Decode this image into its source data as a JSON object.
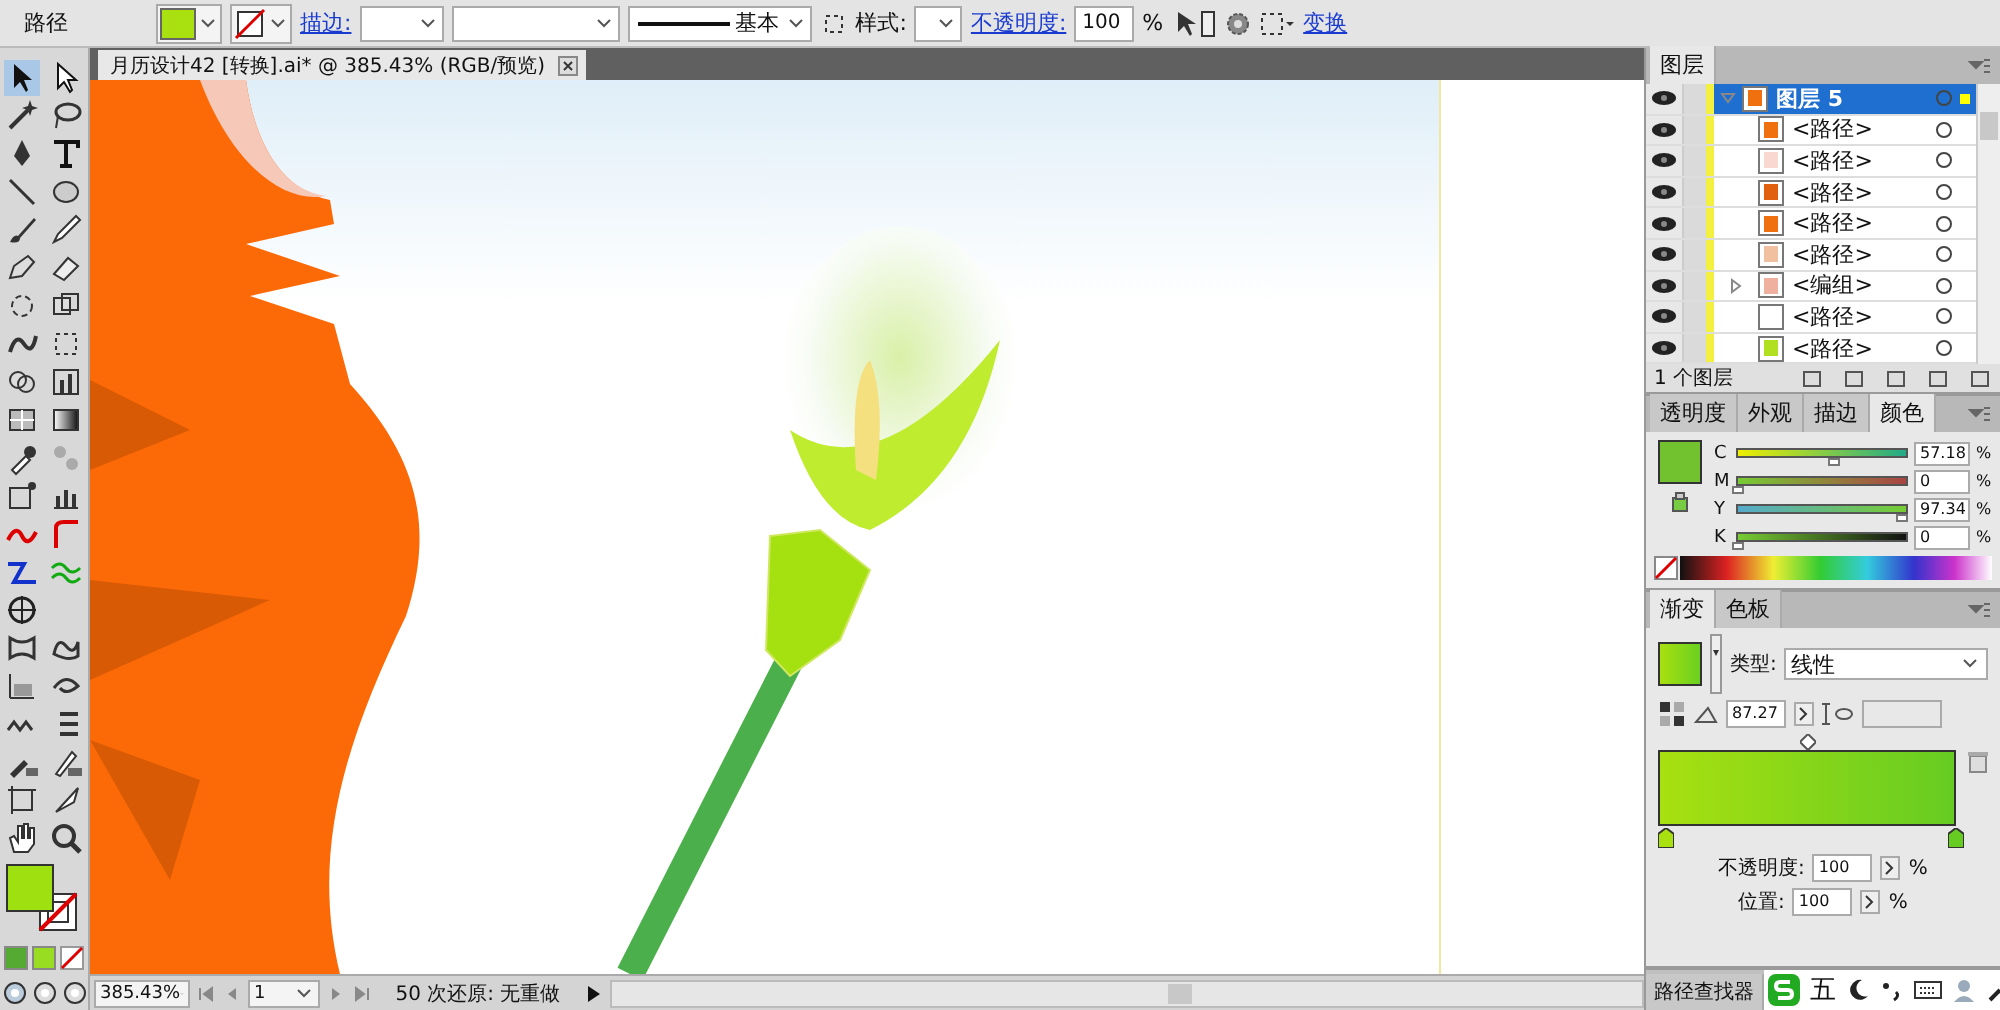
{
  "control_bar": {
    "object_label": "路径",
    "stroke_label": "描边:",
    "stroke_profile": "基本",
    "style_label": "样式:",
    "opacity_label": "不透明度:",
    "opacity_value": "100",
    "opacity_unit": "%",
    "transform_link": "变换"
  },
  "document_tab": {
    "title": "月历设计42 [转换].ai* @ 385.43% (RGB/预览)"
  },
  "layers_panel": {
    "tab": "图层",
    "layers": [
      {
        "name": "图层 5",
        "selected": true,
        "visible": true,
        "expanded": true,
        "children": [
          {
            "name": "<路径>",
            "visible": true,
            "color": "#f07010"
          },
          {
            "name": "<路径>",
            "visible": true,
            "color": "#f8d8d0"
          },
          {
            "name": "<路径>",
            "visible": true,
            "color": "#e06010"
          },
          {
            "name": "<路径>",
            "visible": true,
            "color": "#f07010"
          },
          {
            "name": "<路径>",
            "visible": true,
            "color": "#f0c0a0"
          },
          {
            "name": "<编组>",
            "visible": true,
            "expanded": false,
            "color": "#f0b0a0"
          },
          {
            "name": "<路径>",
            "visible": true,
            "color": "#ffffff"
          },
          {
            "name": "<路径>",
            "visible": true,
            "color": "#b0e020"
          }
        ]
      }
    ],
    "footer": "1 个图层"
  },
  "color_panel": {
    "tabs": [
      {
        "label": "透明度",
        "selected": false
      },
      {
        "label": "外观",
        "selected": false
      },
      {
        "label": "描边",
        "selected": false
      },
      {
        "label": "颜色",
        "selected": true
      }
    ],
    "channels": [
      {
        "name": "C",
        "level": 0.5718,
        "value": "57.18",
        "unit": "%"
      },
      {
        "name": "M",
        "level": 0,
        "value": "0",
        "unit": "%"
      },
      {
        "name": "Y",
        "level": 0.9734,
        "value": "97.34",
        "unit": "%"
      },
      {
        "name": "K",
        "level": 0,
        "value": "0",
        "unit": "%"
      }
    ]
  },
  "gradient_panel": {
    "tabs": [
      {
        "label": "渐变",
        "selected": true
      },
      {
        "label": "色板",
        "selected": false
      }
    ],
    "stops": [
      {
        "color": "#a8e010"
      },
      {
        "color": "#66cc22"
      }
    ],
    "type_label": "类型:",
    "type_value": "线性",
    "angle": "87.27",
    "opacity_label": "不透明度:",
    "opacity_value": "100",
    "opacity_unit": "%",
    "location_label": "位置:",
    "location_value": "100",
    "location_unit": "%"
  },
  "bottom_panel": {
    "tab": "路径查找器",
    "ime_label": "五"
  },
  "status_bar": {
    "zoom": "385.43%",
    "page": "1",
    "status": "50 次还原: 无重做"
  }
}
